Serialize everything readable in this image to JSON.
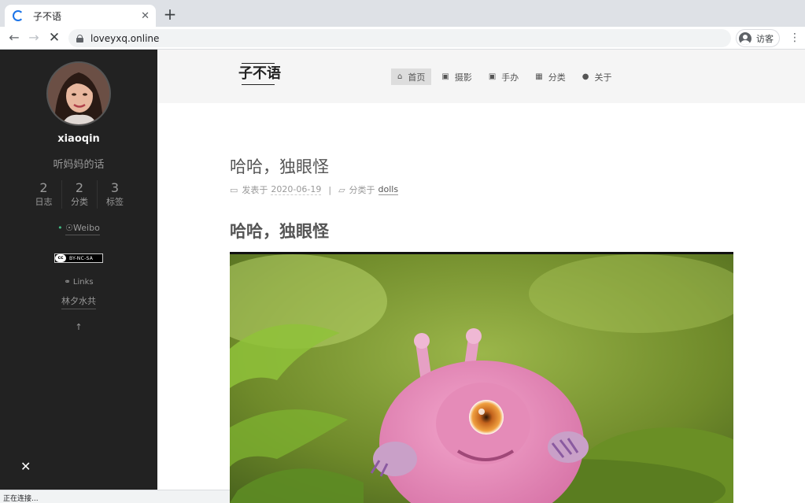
{
  "browser": {
    "tab_title": "子不语",
    "tab_close": "✕",
    "new_tab": "+",
    "url": "loveyxq.online",
    "profile_label": "访客",
    "back": "←",
    "forward": "→",
    "stop": "✕",
    "menu": "⋮",
    "status_text": "正在连接..."
  },
  "sidebar": {
    "author_name": "xiaoqin",
    "motto": "听妈妈的话",
    "stats": [
      {
        "count": "2",
        "label": "日志"
      },
      {
        "count": "2",
        "label": "分类"
      },
      {
        "count": "3",
        "label": "标签"
      }
    ],
    "social_label": "Weibo",
    "cc_label": "BY-NC-SA",
    "cc_logo": "cc",
    "links_title": "Links",
    "links_items": [
      "林夕水共"
    ],
    "back_to_top": "↑",
    "close": "✕"
  },
  "header": {
    "brand": "子不语",
    "menu": [
      {
        "label": "首页",
        "icon": "home-icon",
        "glyph": "⌂",
        "active": true
      },
      {
        "label": "摄影",
        "icon": "camera-icon",
        "glyph": "▣"
      },
      {
        "label": "手办",
        "icon": "camera-icon",
        "glyph": "▣"
      },
      {
        "label": "分类",
        "icon": "grid-icon",
        "glyph": "▦"
      },
      {
        "label": "关于",
        "icon": "user-icon",
        "glyph": "●"
      }
    ]
  },
  "post": {
    "title": "哈哈，独眼怪",
    "meta_posted_label": "发表于",
    "meta_date": "2020-06-19",
    "meta_sep": "|",
    "meta_category_label": "分类于",
    "meta_category": "dolls",
    "heading": "哈哈，独眼怪"
  },
  "colors": {
    "sidebar_bg": "#222222",
    "header_bg": "#f5f5f5",
    "accent_green": "#42b983",
    "monster_pink": "#e88ab8",
    "foliage_green": "#6f9a2e"
  }
}
